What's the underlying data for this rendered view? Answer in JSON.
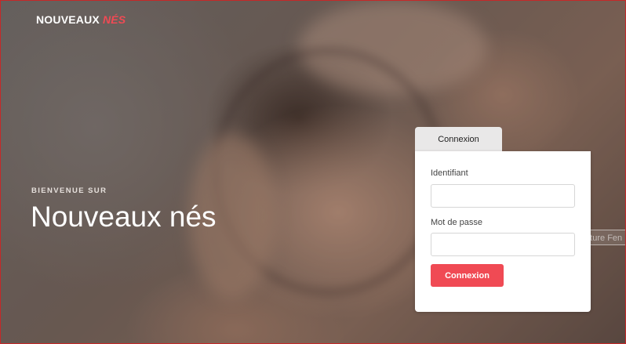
{
  "brand": {
    "name": "NOUVEAUX",
    "accent": "NÉS"
  },
  "hero": {
    "welcome": "BIENVENUE SUR",
    "title": "Nouveaux nés"
  },
  "login": {
    "tab_label": "Connexion",
    "username_label": "Identifiant",
    "username_value": "",
    "password_label": "Mot de passe",
    "password_value": "",
    "submit_label": "Connexion"
  },
  "overlay": {
    "partial_text": "Capture Fen"
  },
  "colors": {
    "accent": "#f04a54",
    "tab_bg": "#e9e8e8",
    "card_bg": "#ffffff"
  },
  "background": {
    "image": "sleeping-newborn-photo"
  }
}
